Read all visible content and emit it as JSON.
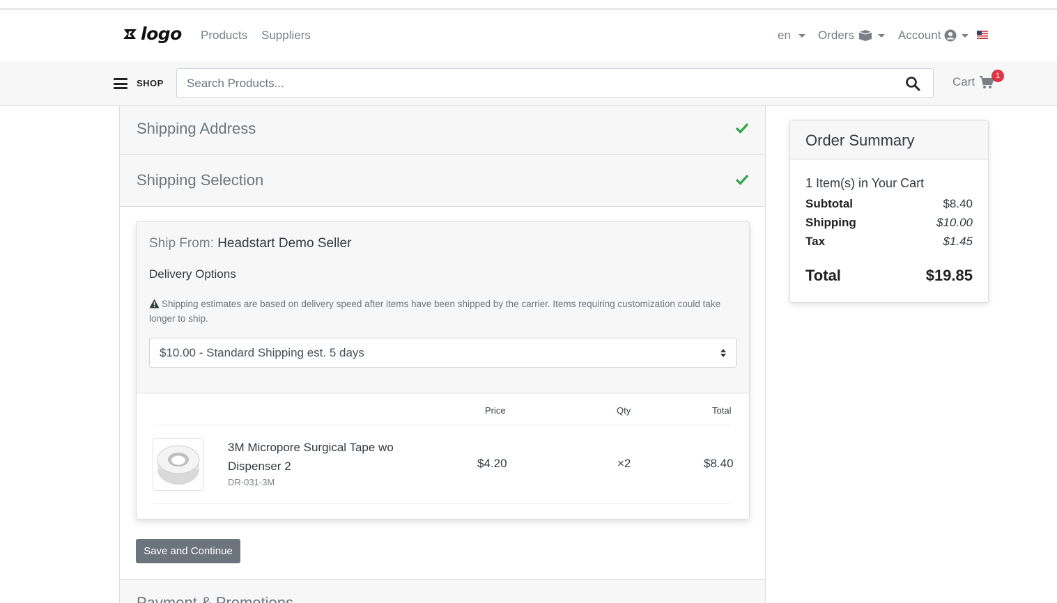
{
  "nav": {
    "logo_text": "logo",
    "products": "Products",
    "suppliers": "Suppliers",
    "language": "en",
    "orders": "Orders",
    "account": "Account"
  },
  "search": {
    "shop_label": "SHOP",
    "placeholder": "Search Products...",
    "cart_label": "Cart",
    "cart_count": "1"
  },
  "checkout": {
    "shipping_address_title": "Shipping Address",
    "shipping_selection_title": "Shipping Selection",
    "ship_from_label": "Ship From:",
    "ship_from_seller": "Headstart Demo Seller",
    "delivery_options_label": "Delivery Options",
    "notice": "Shipping estimates are based on delivery speed after items have been shipped by the carrier. Items requiring customization could take longer to ship.",
    "selected_option": "$10.00 - Standard Shipping est. 5 days",
    "table_headers": {
      "price": "Price",
      "qty": "Qty",
      "total": "Total"
    },
    "line_item": {
      "name": "3M Micropore Surgical Tape wo Dispenser 2",
      "sku": "DR-031-3M",
      "price": "$4.20",
      "qty": "×2",
      "total": "$8.40"
    },
    "save_button": "Save and Continue",
    "next_section_title": "Payment & Promotions"
  },
  "summary": {
    "title": "Order Summary",
    "item_count": "1 Item(s) in Your Cart",
    "subtotal_label": "Subtotal",
    "subtotal_value": "$8.40",
    "shipping_label": "Shipping",
    "shipping_value": "$10.00",
    "tax_label": "Tax",
    "tax_value": "$1.45",
    "total_label": "Total",
    "total_value": "$19.85"
  },
  "colors": {
    "check_green": "#28a745",
    "badge_red": "#dc3545",
    "button_gray": "#6c757d"
  },
  "icons": [
    "logo-icon",
    "box-icon",
    "user-circle-icon",
    "us-flag-icon",
    "hamburger-icon",
    "search-icon",
    "cart-icon",
    "check-icon",
    "warning-icon",
    "select-arrows-icon"
  ]
}
